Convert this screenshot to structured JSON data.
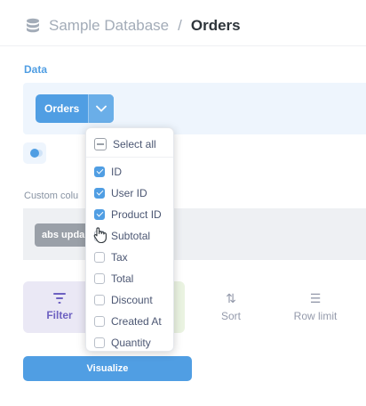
{
  "header": {
    "database": "Sample Database",
    "separator": "/",
    "table": "Orders",
    "icon": "database-icon"
  },
  "data_section": {
    "label": "Data",
    "table_pill": "Orders",
    "chevron_icon": "chevron-down-icon"
  },
  "custom_column": {
    "label": "Custom colu",
    "chip": "abs upda"
  },
  "actions": {
    "filter": "Filter",
    "sort": "Sort",
    "row_limit": "Row limit"
  },
  "visualize": "Visualize",
  "dropdown": {
    "select_all": "Select all",
    "items": [
      {
        "label": "ID",
        "checked": true
      },
      {
        "label": "User ID",
        "checked": true
      },
      {
        "label": "Product ID",
        "checked": true
      },
      {
        "label": "Subtotal",
        "checked": false
      },
      {
        "label": "Tax",
        "checked": false
      },
      {
        "label": "Total",
        "checked": false
      },
      {
        "label": "Discount",
        "checked": false
      },
      {
        "label": "Created At",
        "checked": false
      },
      {
        "label": "Quantity",
        "checked": false
      }
    ]
  },
  "colors": {
    "brand": "#509ee3",
    "filter": "#6d61c1",
    "summarize": "#88bf4d"
  }
}
